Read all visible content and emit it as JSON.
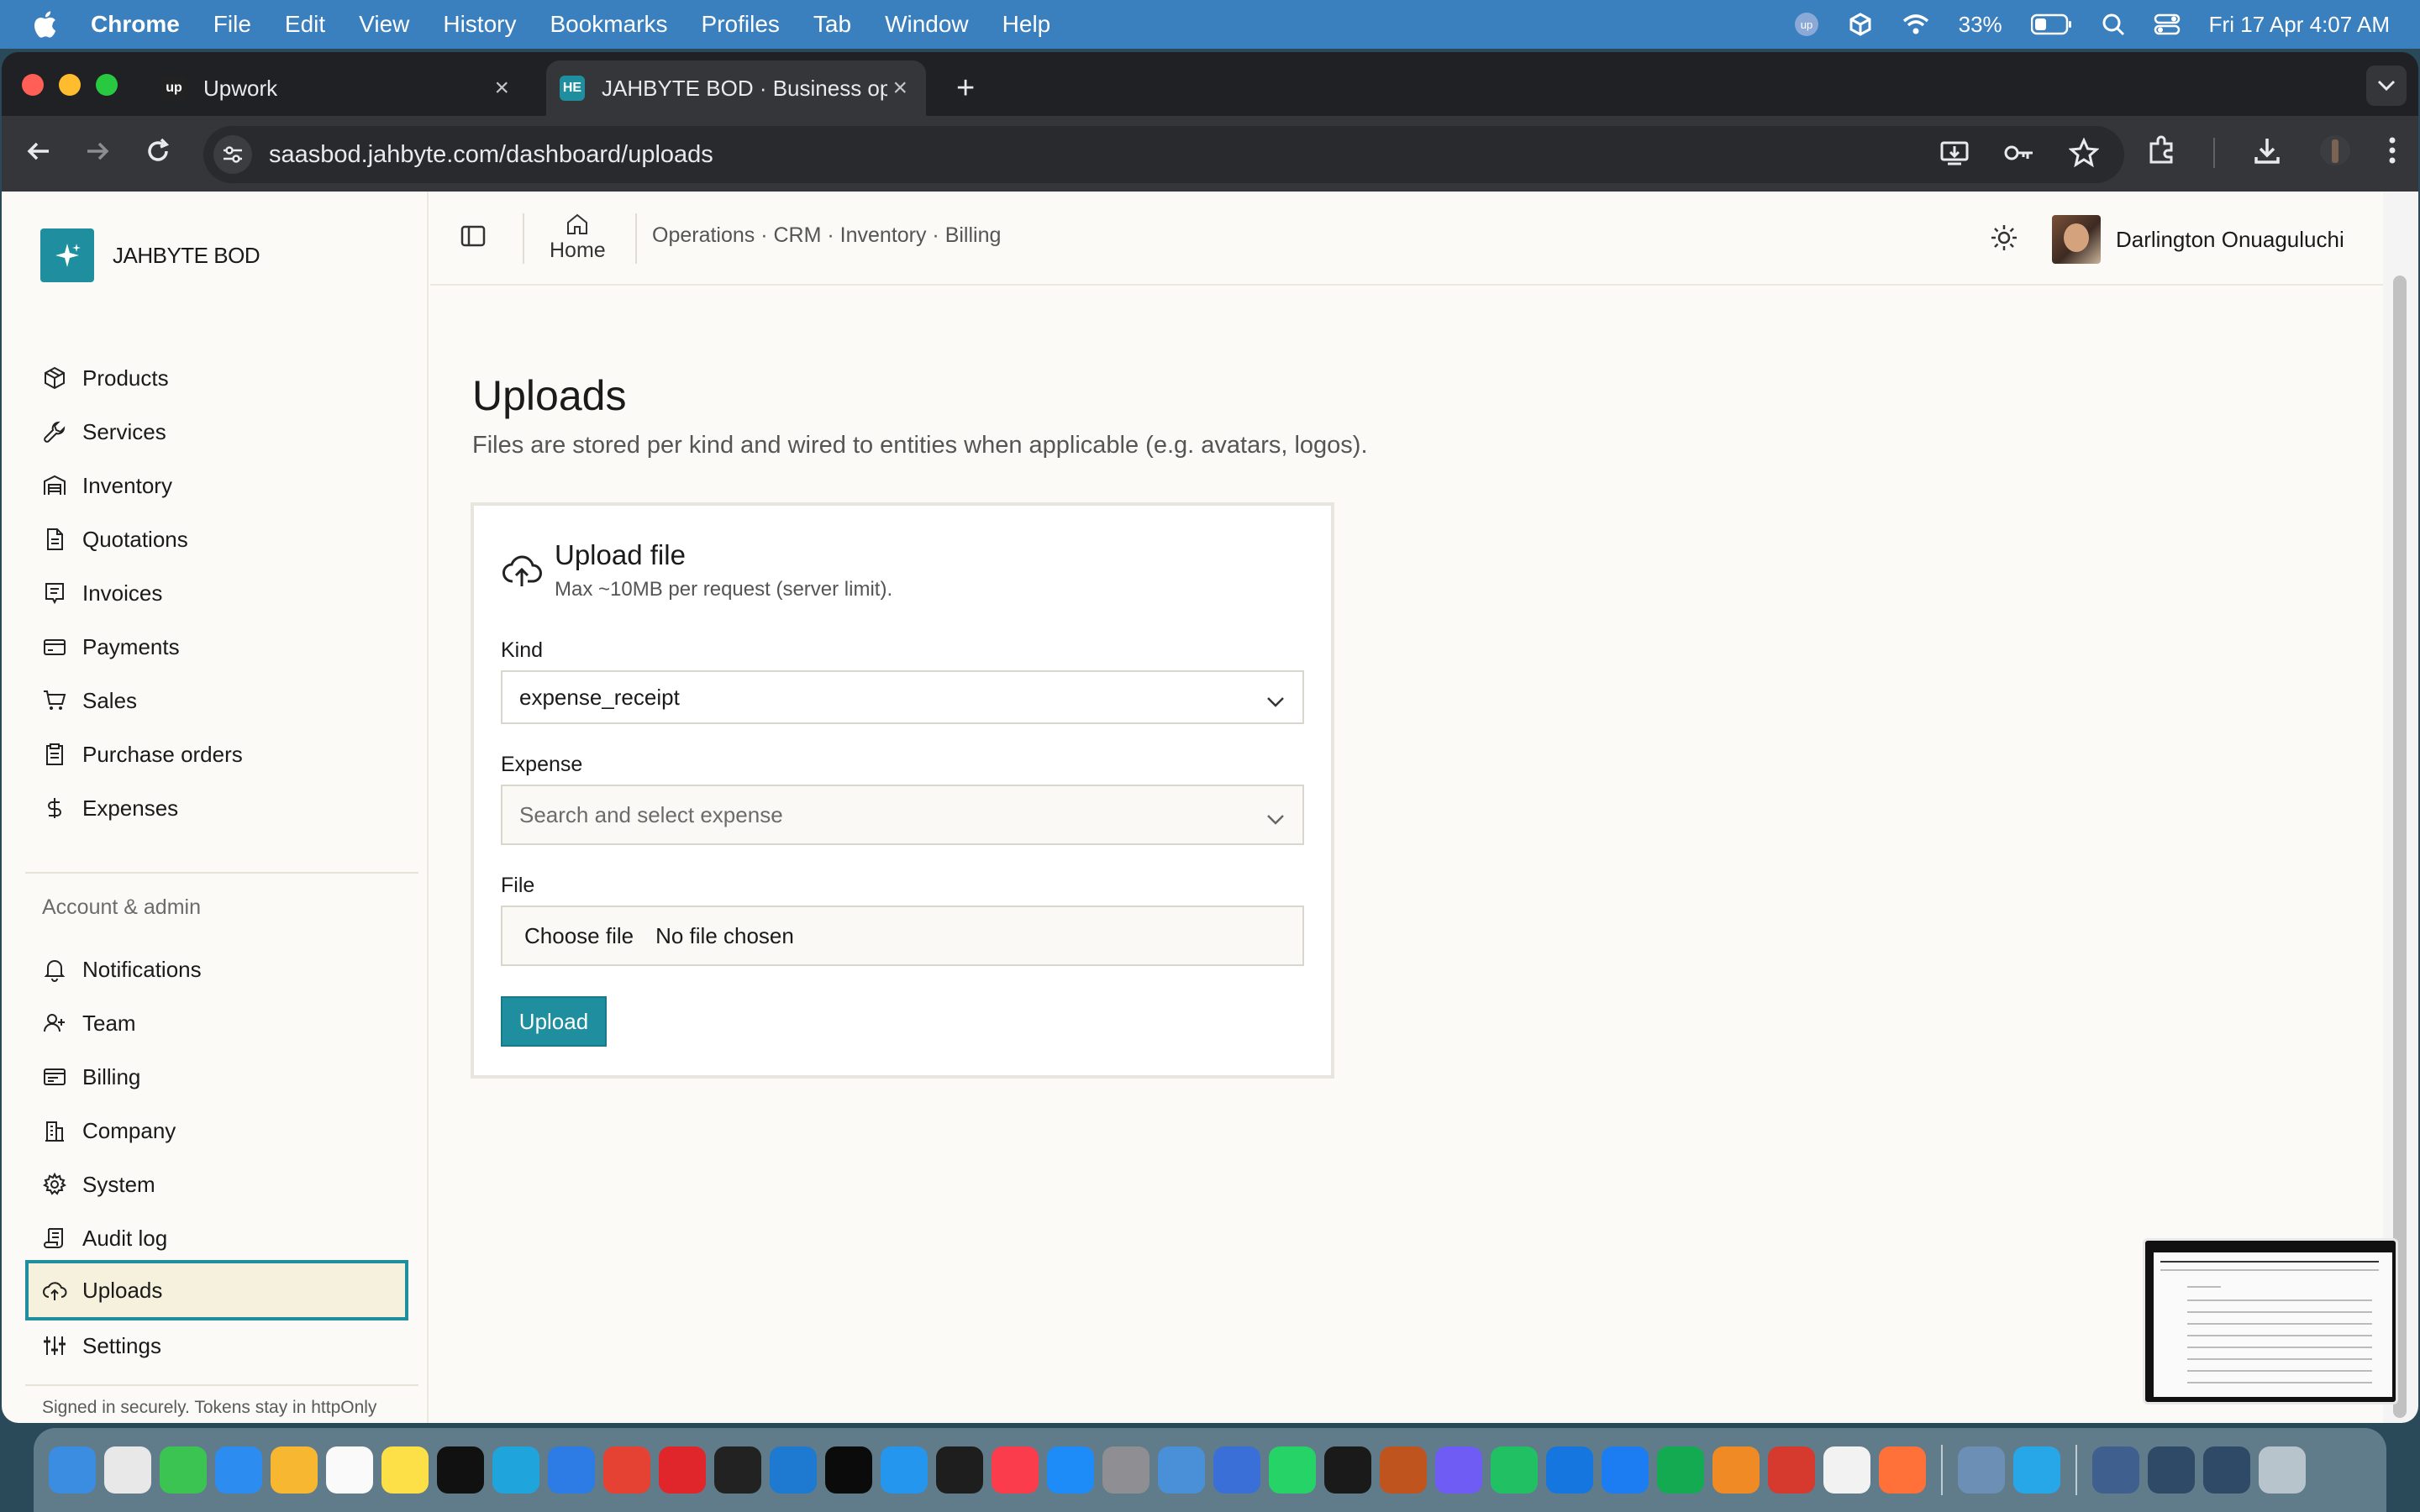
{
  "menubar": {
    "app_name": "Chrome",
    "items": [
      "File",
      "Edit",
      "View",
      "History",
      "Bookmarks",
      "Profiles",
      "Tab",
      "Window",
      "Help"
    ],
    "battery": "33%",
    "clock": "Fri 17 Apr  4:07 AM"
  },
  "browser": {
    "tabs": [
      {
        "title": "Upwork",
        "favicon": "upwork-logo"
      },
      {
        "title": "JAHBYTE BOD · Business ope",
        "favicon": "jahbyte-logo"
      }
    ],
    "url": "saasbod.jahbyte.com/dashboard/uploads"
  },
  "sidebar": {
    "brand": "JAHBYTE BOD",
    "items": [
      {
        "label": "Products",
        "icon": "package-icon"
      },
      {
        "label": "Services",
        "icon": "wrench-icon"
      },
      {
        "label": "Inventory",
        "icon": "warehouse-icon"
      },
      {
        "label": "Quotations",
        "icon": "document-icon"
      },
      {
        "label": "Invoices",
        "icon": "receipt-icon"
      },
      {
        "label": "Payments",
        "icon": "credit-card-icon"
      },
      {
        "label": "Sales",
        "icon": "cart-icon"
      },
      {
        "label": "Purchase orders",
        "icon": "clipboard-icon"
      },
      {
        "label": "Expenses",
        "icon": "dollar-icon"
      }
    ],
    "section_title": "Account & admin",
    "admin_items": [
      {
        "label": "Notifications",
        "icon": "bell-icon"
      },
      {
        "label": "Team",
        "icon": "user-plus-icon"
      },
      {
        "label": "Billing",
        "icon": "billing-icon"
      },
      {
        "label": "Company",
        "icon": "building-icon"
      },
      {
        "label": "System",
        "icon": "gear-icon"
      },
      {
        "label": "Audit log",
        "icon": "scroll-icon"
      },
      {
        "label": "Uploads",
        "icon": "cloud-upload-icon",
        "active": true
      },
      {
        "label": "Settings",
        "icon": "sliders-icon"
      }
    ],
    "footnote": "Signed in securely. Tokens stay in httpOnly cookies."
  },
  "topbar": {
    "home_label": "Home",
    "breadcrumb": "Operations · CRM · Inventory · Billing",
    "user_name": "Darlington Onuaguluchi"
  },
  "main": {
    "title": "Uploads",
    "subtitle": "Files are stored per kind and wired to entities when applicable (e.g. avatars, logos).",
    "card": {
      "title": "Upload file",
      "subtitle": "Max ~10MB per request (server limit).",
      "kind_label": "Kind",
      "kind_value": "expense_receipt",
      "expense_label": "Expense",
      "expense_placeholder": "Search and select expense",
      "file_label": "File",
      "choose_file": "Choose file",
      "no_file": "No file chosen",
      "upload_button": "Upload"
    }
  },
  "colors": {
    "accent": "#1f8fa0",
    "active_bg": "#f6f1dc",
    "menubar": "#3a7fbe"
  }
}
